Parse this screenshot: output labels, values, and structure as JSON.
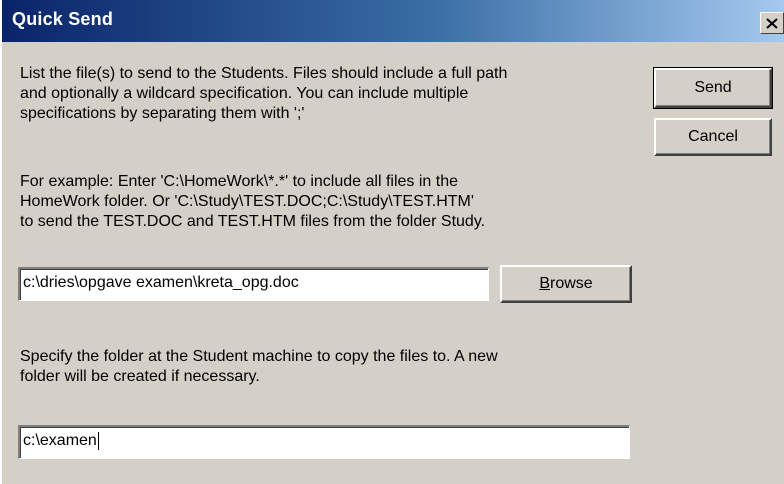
{
  "window": {
    "title": "Quick Send",
    "close_icon": "close-icon"
  },
  "instructions": {
    "line1": "List the file(s) to send to the Students. Files should include a full path",
    "line2": "and optionally a wildcard specification. You can include multiple",
    "line3": "specifications by separating them with ';'"
  },
  "example": {
    "line1": "For example: Enter 'C:\\HomeWork\\*.*' to include all files in the",
    "line2": "HomeWork folder. Or 'C:\\Study\\TEST.DOC;C:\\Study\\TEST.HTM'",
    "line3": "to send the TEST.DOC and TEST.HTM files from the folder Study."
  },
  "file_input": {
    "value": "c:\\dries\\opgave examen\\kreta_opg.doc"
  },
  "browse_button": {
    "accel": "B",
    "rest": "rowse"
  },
  "folder_instructions": {
    "line1": "Specify the folder at the Student machine to copy the files to. A new",
    "line2": "folder will be created if necessary."
  },
  "folder_input": {
    "value": "c:\\examen"
  },
  "actions": {
    "send_label": "Send",
    "cancel_label": "Cancel"
  }
}
